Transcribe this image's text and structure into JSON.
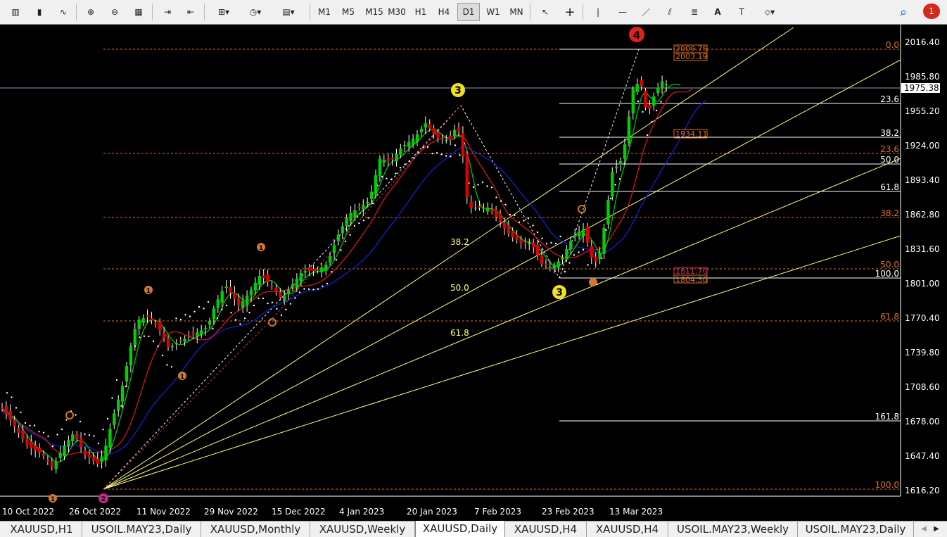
{
  "toolbar": {
    "left_icons": [
      {
        "name": "bar-chart-icon",
        "glyph": "▥"
      },
      {
        "name": "candlestick-icon",
        "glyph": "▮"
      },
      {
        "name": "line-chart-icon",
        "glyph": "∿"
      },
      {
        "name": "zoom-in-icon",
        "glyph": "⊕"
      },
      {
        "name": "zoom-out-icon",
        "glyph": "⊖"
      },
      {
        "name": "tile-windows-icon",
        "glyph": "▦"
      },
      {
        "name": "chart-shift-icon",
        "glyph": "⇥"
      },
      {
        "name": "autoscroll-icon",
        "glyph": "⇤"
      },
      {
        "name": "indicators-icon",
        "glyph": "⊞▾"
      },
      {
        "name": "periods-clock-icon",
        "glyph": "◷▾"
      },
      {
        "name": "templates-icon",
        "glyph": "▤▾"
      }
    ],
    "timeframes": [
      "M1",
      "M5",
      "M15",
      "M30",
      "H1",
      "H4",
      "D1",
      "W1",
      "MN"
    ],
    "active_timeframe": "D1",
    "draw_tools": [
      {
        "name": "cursor-icon",
        "glyph": "↖"
      },
      {
        "name": "crosshair-icon",
        "glyph": "+"
      },
      {
        "name": "vertical-line-icon",
        "glyph": "|"
      },
      {
        "name": "horizontal-line-icon",
        "glyph": "—"
      },
      {
        "name": "trendline-icon",
        "glyph": "／"
      },
      {
        "name": "channels-icon",
        "glyph": "⫽"
      },
      {
        "name": "fibonacci-icon",
        "glyph": "≣"
      },
      {
        "name": "text-icon",
        "glyph": "A"
      },
      {
        "name": "text-label-icon",
        "glyph": "T"
      },
      {
        "name": "arrows-icon",
        "glyph": "⬦▾"
      }
    ],
    "search_icon": "⌕",
    "notification_count": "1"
  },
  "chart": {
    "symbol": "XAUUSD",
    "timeframe": "Daily",
    "current_price": "1975.38",
    "price_axis": [
      "2016.40",
      "1985.80",
      "1955.20",
      "1924.00",
      "1893.40",
      "1862.80",
      "1831.60",
      "1801.00",
      "1770.40",
      "1739.80",
      "1708.60",
      "1678.00",
      "1647.40",
      "1616.20"
    ],
    "date_axis": [
      "10 Oct 2022",
      "26 Oct 2022",
      "11 Nov 2022",
      "29 Nov 2022",
      "15 Dec 2022",
      "4 Jan 2023",
      "20 Jan 2023",
      "7 Feb 2023",
      "23 Feb 2023",
      "13 Mar 2023"
    ],
    "fib_major_levels": [
      "0.0",
      "23.6",
      "38.2",
      "50.0",
      "61.8",
      "100.0"
    ],
    "fib_minor_levels": [
      "23.6",
      "38.2",
      "50.0",
      "61.8",
      "100.0",
      "161.8"
    ],
    "fib_fan_labels": [
      "38.2",
      "50.0",
      "61.8"
    ],
    "price_boxes": [
      "2009.75",
      "2003.19",
      "1934.11",
      "1811.70",
      "1804.50"
    ],
    "wave_labels": {
      "w4": "4",
      "w3_top": "3",
      "w3_bottom": "3",
      "w2": "2",
      "minor_1": "1",
      "minor_1b": "1",
      "minor_1c": "1",
      "minor_1d": "1"
    },
    "colors": {
      "background": "#000000",
      "bull_candle": "#00d000",
      "bear_candle": "#e00000",
      "ma_fast": "#00c000",
      "ma_mid": "#d01818",
      "ma_slow": "#1020d0",
      "fib_major": "#e07020",
      "fib_minor": "#ffffff",
      "fan": "#ffff80",
      "axis_text": "#ffffff"
    }
  },
  "tabs": [
    {
      "label": "XAUUSD,H1",
      "active": false
    },
    {
      "label": "USOIL.MAY23,Daily",
      "active": false
    },
    {
      "label": "XAUUSD,Monthly",
      "active": false
    },
    {
      "label": "XAUUSD,Weekly",
      "active": false
    },
    {
      "label": "XAUUSD,Daily",
      "active": true
    },
    {
      "label": "XAUUSD,H4",
      "active": false
    },
    {
      "label": "XAUUSD,H4",
      "active": false
    },
    {
      "label": "USOIL.MAY23,Weekly",
      "active": false
    },
    {
      "label": "USOIL.MAY23,Daily",
      "active": false
    }
  ],
  "tab_scroll": {
    "left": "◀",
    "right": "▶"
  }
}
